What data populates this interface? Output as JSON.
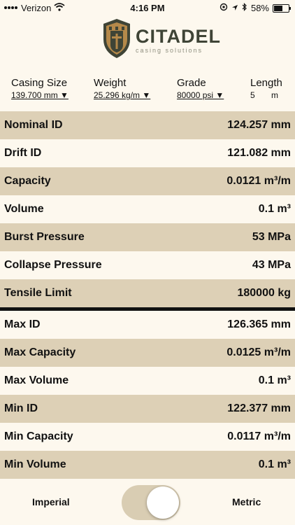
{
  "status_bar": {
    "carrier": "Verizon",
    "time": "4:16 PM",
    "battery": "58%",
    "battery_level": 0.58
  },
  "brand": {
    "name": "CITADEL",
    "tagline": "casing solutions"
  },
  "selectors": {
    "casing_size": {
      "label": "Casing Size",
      "value": "139.700 mm ▼"
    },
    "weight": {
      "label": "Weight",
      "value": "25.296 kg/m ▼"
    },
    "grade": {
      "label": "Grade",
      "value": "80000 psi ▼"
    },
    "length": {
      "label": "Length",
      "value": "5",
      "unit": "m"
    }
  },
  "rows_primary": [
    {
      "label": "Nominal ID",
      "value": "124.257 mm"
    },
    {
      "label": "Drift ID",
      "value": "121.082 mm"
    },
    {
      "label": "Capacity",
      "value": "0.0121 m³/m"
    },
    {
      "label": "Volume",
      "value": "0.1 m³"
    },
    {
      "label": "Burst Pressure",
      "value": "53 MPa"
    },
    {
      "label": "Collapse Pressure",
      "value": "43 MPa"
    },
    {
      "label": "Tensile Limit",
      "value": "180000 kg"
    }
  ],
  "rows_secondary": [
    {
      "label": "Max ID",
      "value": "126.365 mm"
    },
    {
      "label": "Max Capacity",
      "value": "0.0125 m³/m"
    },
    {
      "label": "Max Volume",
      "value": "0.1 m³"
    },
    {
      "label": "Min ID",
      "value": "122.377 mm"
    },
    {
      "label": "Min Capacity",
      "value": "0.0117 m³/m"
    },
    {
      "label": "Min Volume",
      "value": "0.1 m³"
    }
  ],
  "units_toggle": {
    "left_label": "Imperial",
    "right_label": "Metric",
    "selected": "Metric"
  },
  "colors": {
    "background": "#fdf8ee",
    "row_shade": "#ddd0b6",
    "brand_dark": "#3f4436",
    "brand_accent": "#b5894a"
  }
}
